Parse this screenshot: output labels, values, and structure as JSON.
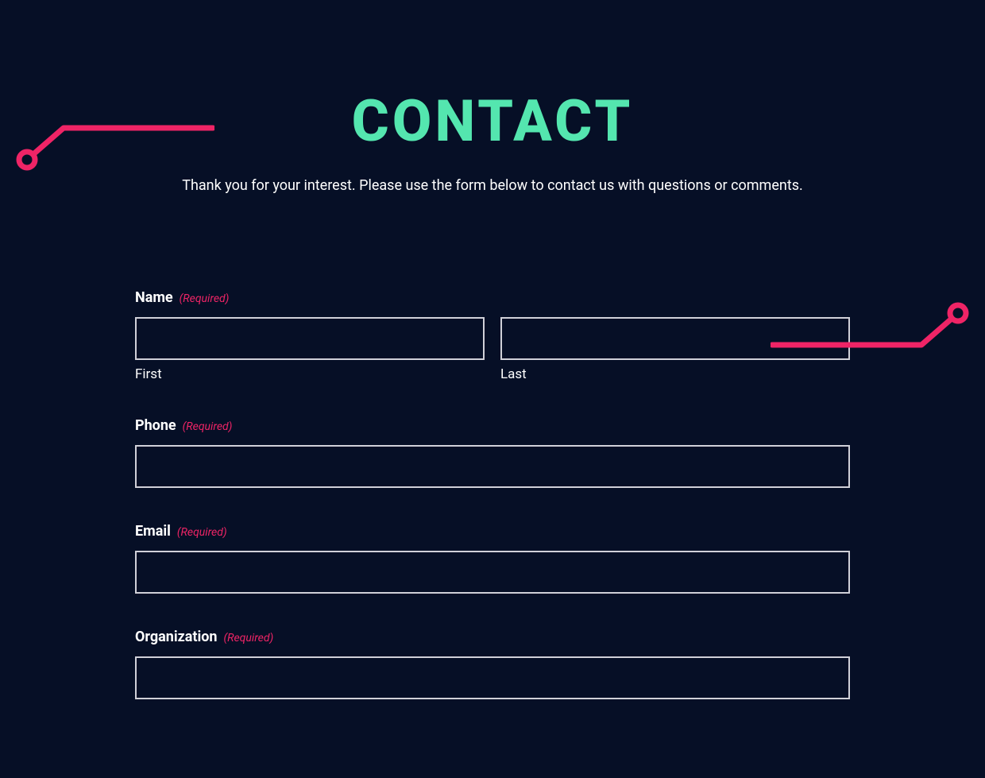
{
  "header": {
    "title": "CONTACT",
    "subtitle": "Thank you for your interest. Please use the form below to contact us with questions or comments."
  },
  "form": {
    "required_tag": "(Required)",
    "name": {
      "label": "Name",
      "first_sublabel": "First",
      "last_sublabel": "Last",
      "first_value": "",
      "last_value": ""
    },
    "phone": {
      "label": "Phone",
      "value": ""
    },
    "email": {
      "label": "Email",
      "value": ""
    },
    "organization": {
      "label": "Organization",
      "value": ""
    }
  },
  "colors": {
    "accent_green": "#54e6af",
    "accent_pink": "#ef2466",
    "bg": "#060f26",
    "input_border": "#d0d0d8"
  }
}
